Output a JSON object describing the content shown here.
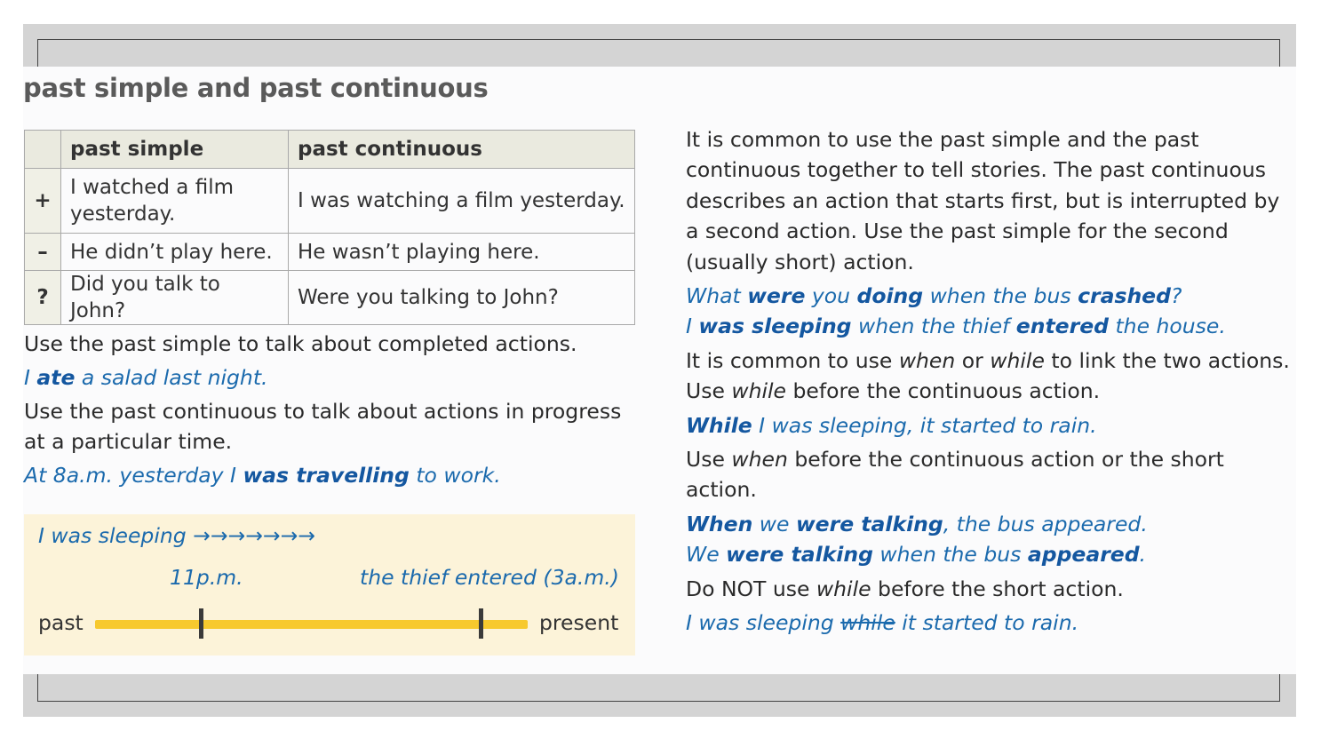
{
  "title": "past simple and past continuous",
  "table": {
    "headers": [
      "past simple",
      "past continuous"
    ],
    "rows": [
      {
        "symbol": "+",
        "past_simple": "I watched a film yesterday.",
        "past_continuous": "I was watching a film yesterday."
      },
      {
        "symbol": "–",
        "past_simple": "He didn’t play here.",
        "past_continuous": "He wasn’t playing here."
      },
      {
        "symbol": "?",
        "past_simple": "Did you talk to John?",
        "past_continuous": "Were you talking to John?"
      }
    ]
  },
  "left": {
    "rule1": "Use the past simple to talk about completed actions.",
    "ex1": {
      "a": "I ",
      "b": "ate",
      "c": " a salad last night."
    },
    "rule2": "Use the past continuous to talk about actions in progress at a particular time.",
    "ex2": {
      "a": "At 8a.m. yesterday I ",
      "b": "was travelling",
      "c": " to work."
    }
  },
  "timeline": {
    "sleeping": "I was sleeping →→→→→→→",
    "time1": "11p.m.",
    "time2": "the thief entered (3a.m.)",
    "past": "past",
    "present": "present",
    "bar_color": "#f7c92e"
  },
  "right": {
    "intro": "It is common to use the past simple and the past continuous together to tell stories. The past continuous describes an action that starts first, but is interrupted by a second action. Use the past simple for the second (usually short) action.",
    "ex1": {
      "a": "What ",
      "b": "were",
      "c": " you ",
      "d": "doing",
      "e": " when the bus ",
      "f": "crashed",
      "g": "?"
    },
    "ex2": {
      "a": "I ",
      "b": "was sleeping",
      "c": " when the thief ",
      "d": "entered",
      "e": " the house."
    },
    "rule_link": {
      "a": "It is common to use ",
      "b": "when",
      "c": " or ",
      "d": "while",
      "e": " to link the two actions."
    },
    "rule_while": {
      "a": "Use ",
      "b": "while",
      "c": " before the continuous action."
    },
    "ex3": {
      "a": "While",
      "b": " I was sleeping, it started to rain."
    },
    "rule_when": {
      "a": "Use ",
      "b": "when",
      "c": " before the continuous action or the short action."
    },
    "ex4": {
      "a": "When",
      "b": " we ",
      "c": "were talking",
      "d": ", the bus appeared."
    },
    "ex5": {
      "a": "We ",
      "b": "were talking",
      "c": " when the bus ",
      "d": "appeared",
      "e": "."
    },
    "rule_not": {
      "a": "Do NOT use ",
      "b": "while",
      "c": " before the short action."
    },
    "ex6": {
      "a": "I was sleeping ",
      "b": "while",
      "c": " it started to rain."
    }
  },
  "colors": {
    "example_blue": "#1b6aad",
    "timeline_bg": "#fcf3d9",
    "header_bg": "#eaeadf",
    "frame_gray": "#d4d4d4"
  }
}
